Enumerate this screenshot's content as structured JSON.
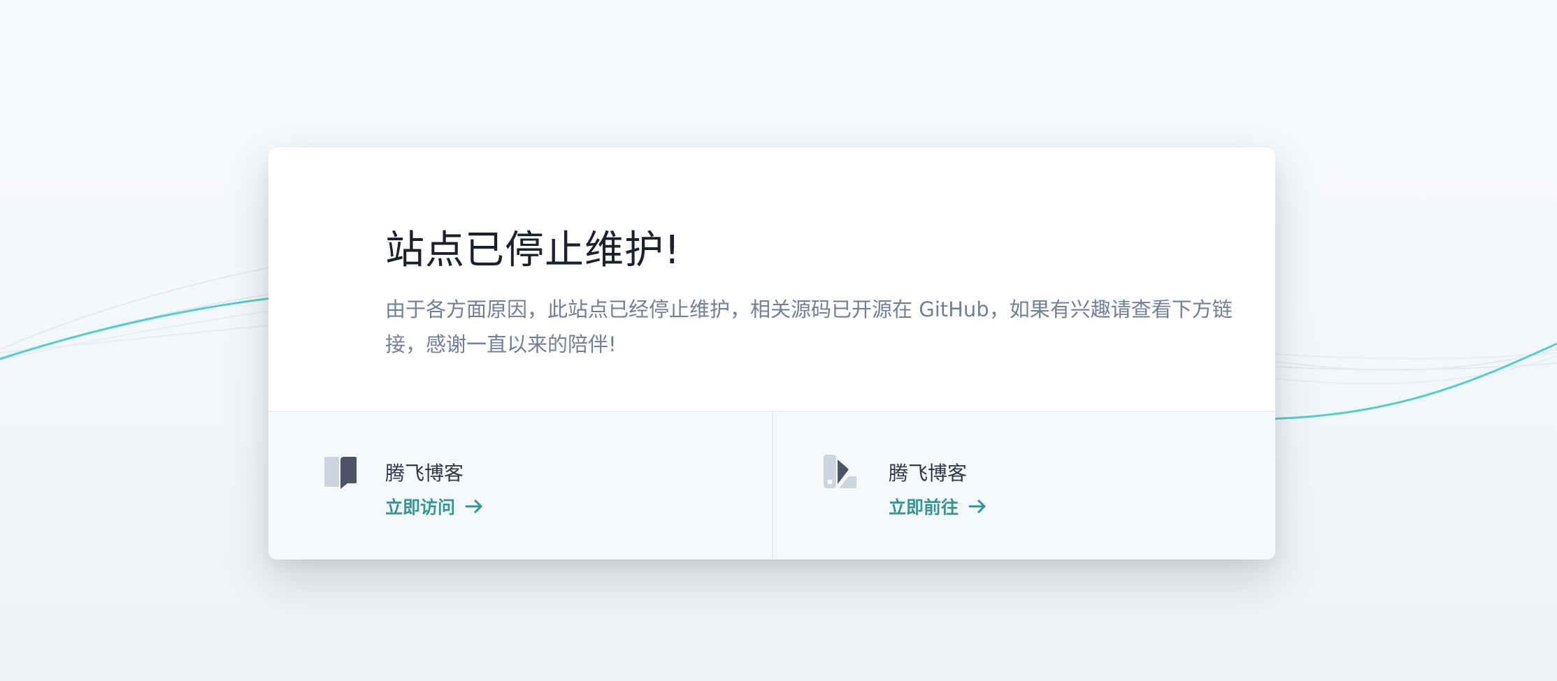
{
  "notice": {
    "title": "站点已停止维护!",
    "description": "由于各方面原因，此站点已经停止维护，相关源码已开源在 GitHub，如果有兴趣请查看下方链接，感谢一直以来的陪伴!"
  },
  "links": [
    {
      "title": "腾飞博客",
      "action": "立即访问",
      "icon": "book-icon"
    },
    {
      "title": "腾飞博客",
      "action": "立即前往",
      "icon": "swatch-icon"
    }
  ],
  "colors": {
    "accent": "#319795",
    "wave": "#4fd1c5",
    "title": "#1a202c",
    "text": "#718096"
  }
}
